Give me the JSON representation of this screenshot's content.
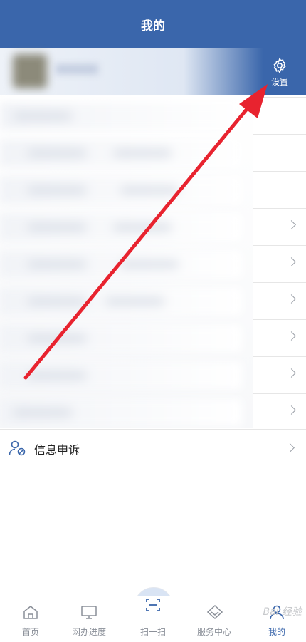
{
  "header": {
    "title": "我的"
  },
  "settings": {
    "label": "设置",
    "icon": "gear-icon"
  },
  "menu": {
    "complaint_label": "信息申诉",
    "complaint_icon": "user-block-icon"
  },
  "bottom_nav": [
    {
      "label": "首页",
      "icon": "home-icon"
    },
    {
      "label": "网办进度",
      "icon": "monitor-icon"
    },
    {
      "label": "扫一扫",
      "icon": "scan-icon"
    },
    {
      "label": "服务中心",
      "icon": "diamond-icon"
    },
    {
      "label": "我的",
      "icon": "person-icon",
      "active": true
    }
  ],
  "watermark": "Bai 经验",
  "colors": {
    "brand": "#3a66ab",
    "annotation_arrow": "#e8232f"
  }
}
